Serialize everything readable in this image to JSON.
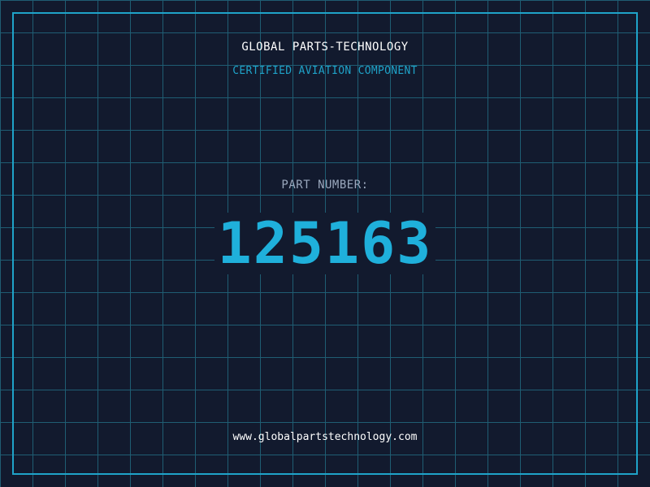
{
  "header": {
    "company_name": "GLOBAL PARTS-TECHNOLOGY",
    "tagline": "CERTIFIED AVIATION COMPONENT"
  },
  "part": {
    "label": "PART NUMBER:",
    "number": "125163"
  },
  "footer": {
    "website": "www.globalpartstechnology.com"
  },
  "colors": {
    "background": "#121a2e",
    "grid": "#1f5d73",
    "accent": "#1fa3c9",
    "part_number": "#1fb0db",
    "label": "#9aa8bd",
    "text": "#ffffff"
  }
}
